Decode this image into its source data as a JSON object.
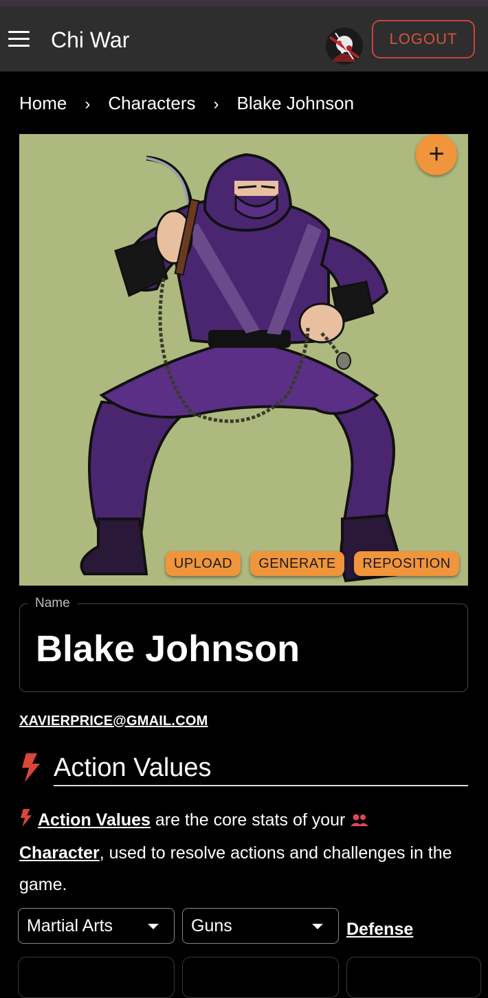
{
  "app": {
    "title": "Chi War",
    "logout_label": "LOGOUT"
  },
  "breadcrumb": [
    {
      "label": "Home"
    },
    {
      "label": "Characters"
    },
    {
      "label": "Blake Johnson"
    }
  ],
  "image_actions": {
    "upload": "UPLOAD",
    "generate": "GENERATE",
    "reposition": "REPOSITION",
    "add_icon": "+"
  },
  "name_field": {
    "label": "Name",
    "value": "Blake Johnson"
  },
  "owner_email": "XAVIERPRICE@GMAIL.COM",
  "action_values": {
    "title": "Action Values",
    "description": {
      "link_action_values": "Action Values",
      "text_1": " are the core stats of your ",
      "link_character": "Character",
      "text_2": ", used to resolve actions and challenges in the game."
    },
    "selects": [
      {
        "value": "Martial Arts"
      },
      {
        "value": "Guns"
      }
    ],
    "defense_label": "Defense"
  },
  "icons": {
    "menu": "menu-icon",
    "bolt": "bolt-icon",
    "people": "people-icon",
    "caret": "caret-down-icon"
  },
  "colors": {
    "accent_orange": "#f0953b",
    "logout_red": "#d5523f",
    "bolt_red": "#d9473a",
    "appbar": "#2e2e2e",
    "image_bg": "#aeb97f",
    "ninja_purple": "#4a2670"
  }
}
